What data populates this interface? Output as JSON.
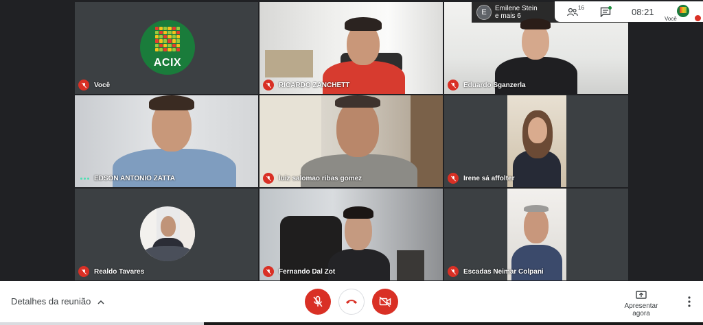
{
  "participants": [
    {
      "name": "Você",
      "muted": true,
      "kind": "logo",
      "logo_text": "ACIX"
    },
    {
      "name": "RICARDO ZANCHETT",
      "muted": true,
      "kind": "video"
    },
    {
      "name": "Eduardo Sganzerla",
      "muted": true,
      "kind": "video"
    },
    {
      "name": "EDSON ANTONIO ZATTA",
      "muted": false,
      "kind": "video"
    },
    {
      "name": "luiz salomao ribas gomez",
      "muted": true,
      "kind": "video"
    },
    {
      "name": "Irene sá affolter",
      "muted": true,
      "kind": "video"
    },
    {
      "name": "Realdo Tavares",
      "muted": true,
      "kind": "avatar"
    },
    {
      "name": "Fernando Dal Zot",
      "muted": true,
      "kind": "video"
    },
    {
      "name": "Escadas Neimar Colpani",
      "muted": true,
      "kind": "video"
    }
  ],
  "others": {
    "initial": "E",
    "line1": "Emilene Stein",
    "line2": "e mais 6"
  },
  "topbar": {
    "people_count": "16",
    "time": "08:21",
    "self_label": "Você",
    "icons": [
      "people-icon",
      "chat-icon"
    ]
  },
  "bottombar": {
    "details_label": "Detalhes da reunião",
    "present_label": "Apresentar agora",
    "controls": [
      "mic-off-icon",
      "hangup-icon",
      "camera-off-icon"
    ]
  },
  "progress": 0.29,
  "colors": {
    "muted_red": "#d93025",
    "logo_green": "#1a7c3b",
    "dark_bg": "#202124"
  }
}
